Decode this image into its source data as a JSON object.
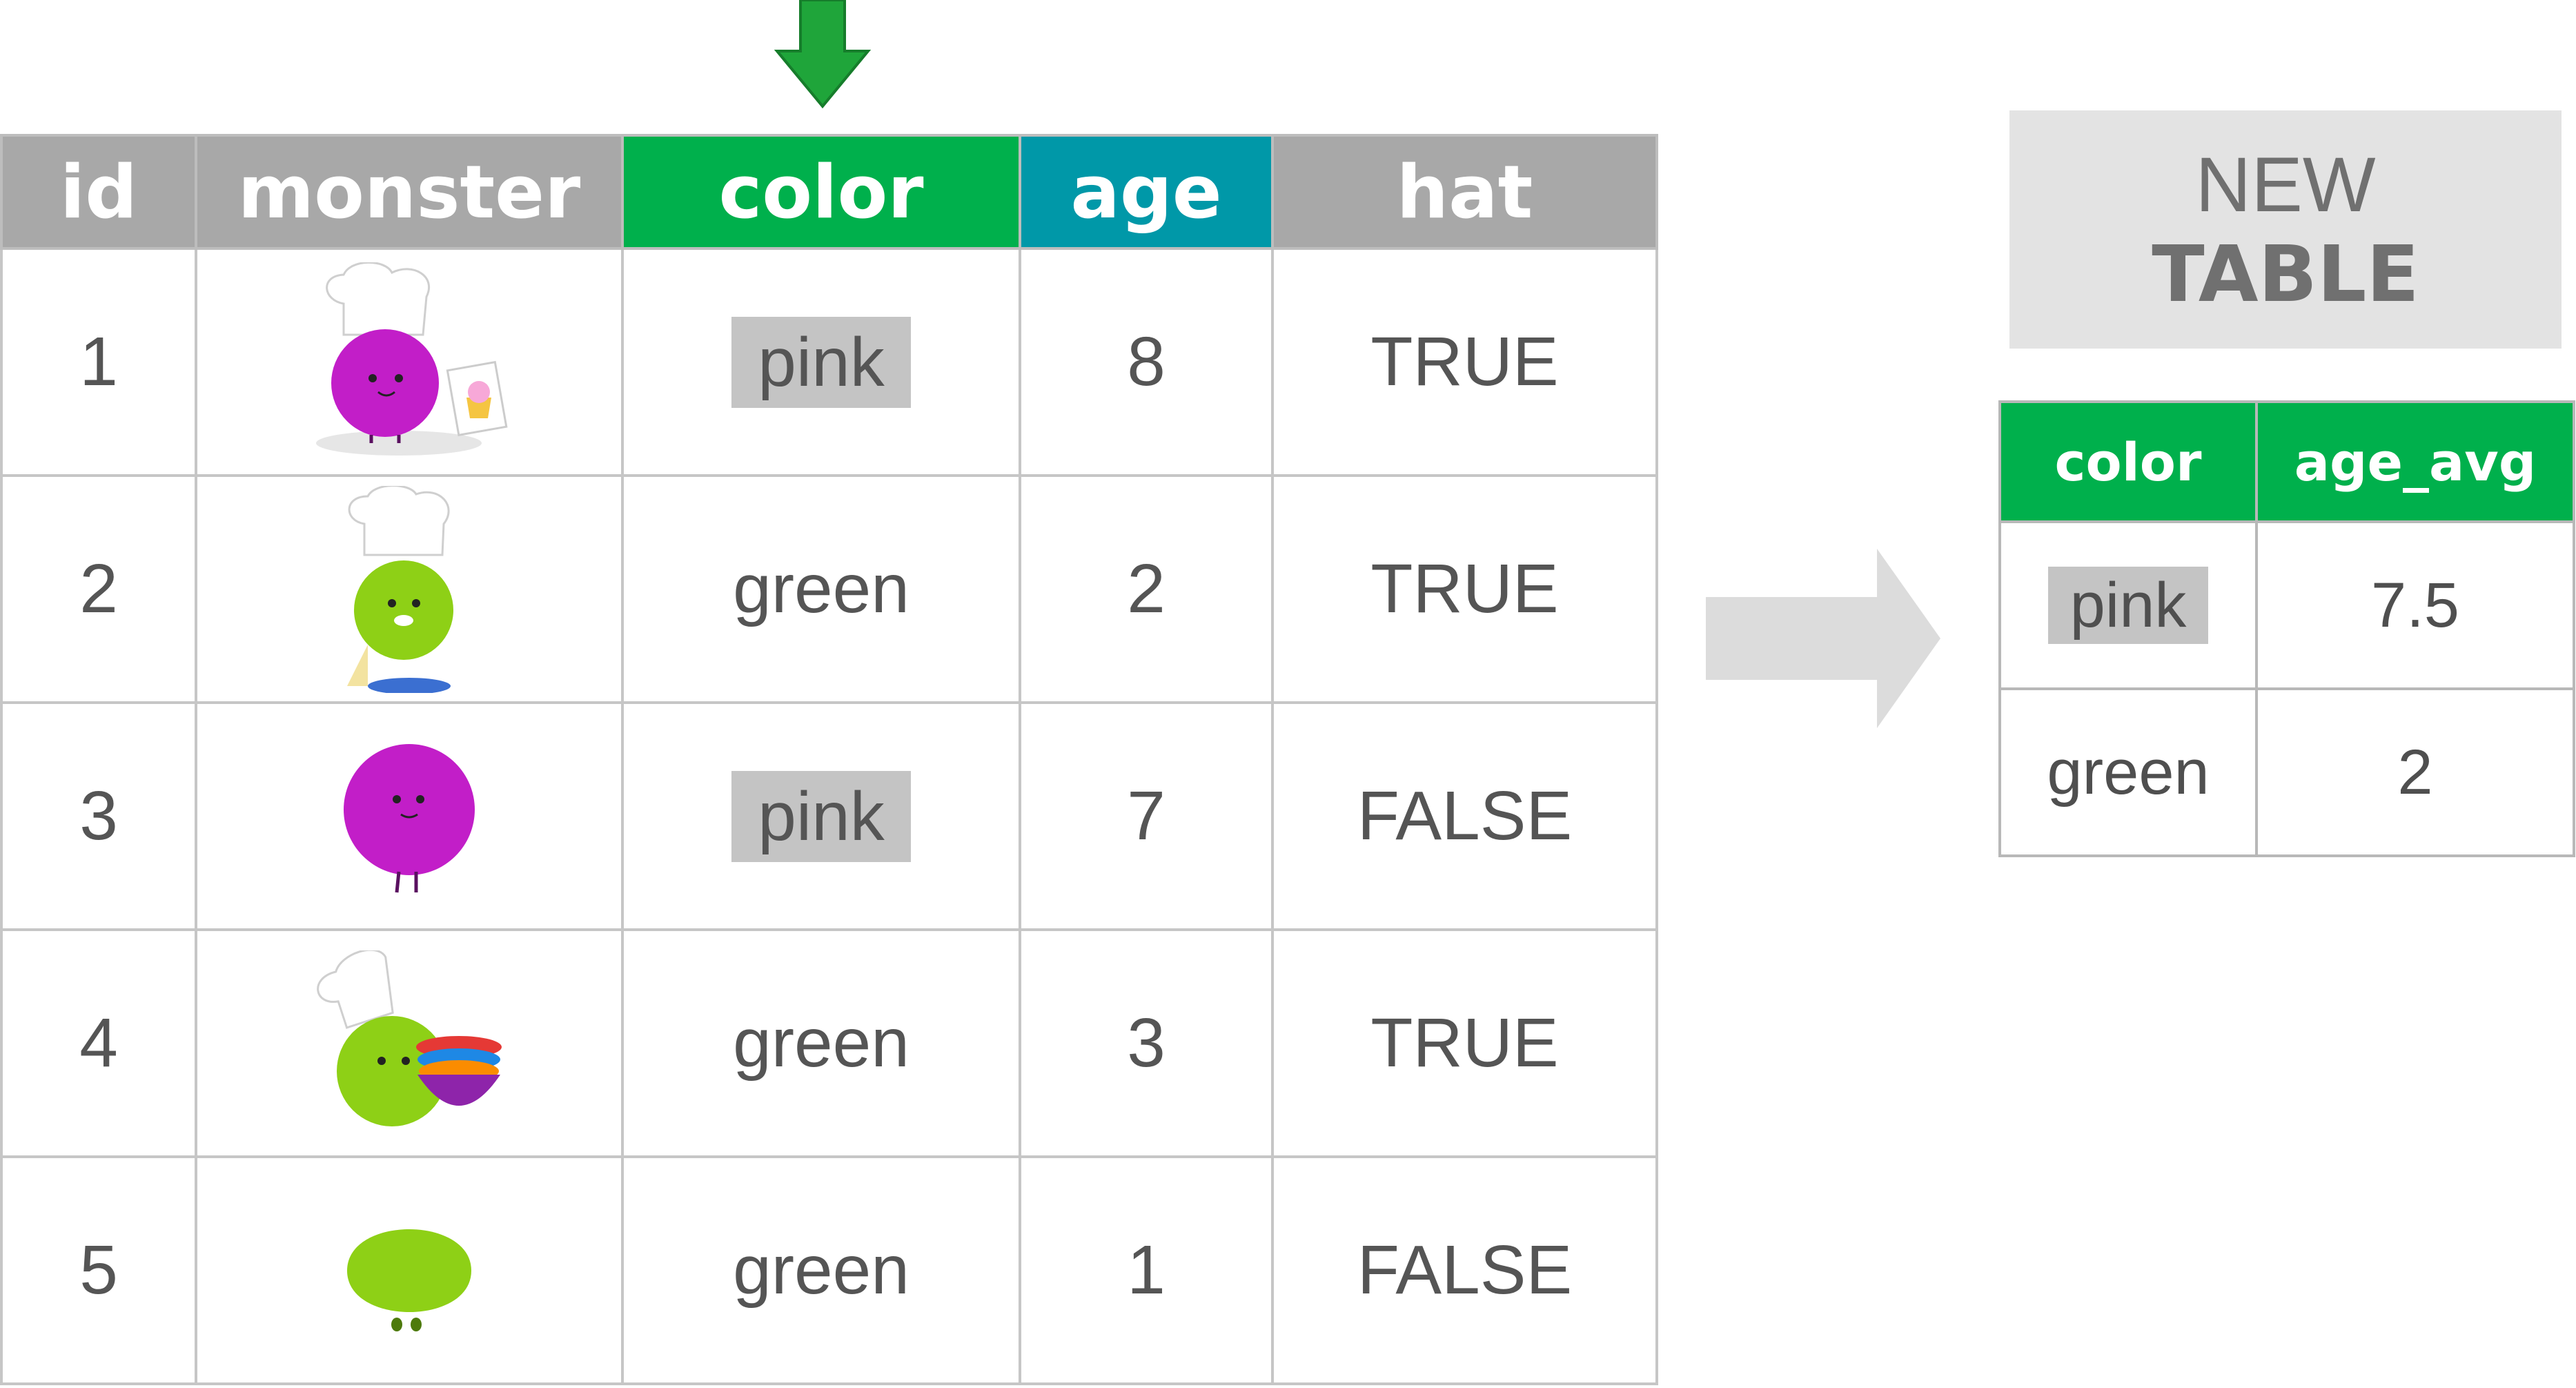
{
  "source_table": {
    "headers": [
      {
        "key": "id",
        "label": "id"
      },
      {
        "key": "monster",
        "label": "monster"
      },
      {
        "key": "color",
        "label": "color"
      },
      {
        "key": "age",
        "label": "age"
      },
      {
        "key": "hat",
        "label": "hat"
      }
    ],
    "rows": [
      {
        "id": "1",
        "monster": "pink chef monster with cupcake",
        "color": "pink",
        "age": "8",
        "hat": "TRUE"
      },
      {
        "id": "2",
        "monster": "green chef monster with piping bag",
        "color": "green",
        "age": "2",
        "hat": "TRUE"
      },
      {
        "id": "3",
        "monster": "pink monster",
        "color": "pink",
        "age": "7",
        "hat": "FALSE"
      },
      {
        "id": "4",
        "monster": "green chef monster with bowls",
        "color": "green",
        "age": "3",
        "hat": "TRUE"
      },
      {
        "id": "5",
        "monster": "green monster",
        "color": "green",
        "age": "1",
        "hat": "FALSE"
      }
    ]
  },
  "new_table": {
    "title_line1": "NEW",
    "title_line2": "TABLE",
    "headers": [
      "color",
      "age_avg"
    ],
    "rows": [
      {
        "color": "pink",
        "age_avg": "7.5"
      },
      {
        "color": "green",
        "age_avg": "2"
      }
    ]
  },
  "colors": {
    "header_grey": "#a8a8a8",
    "group_column_green": "#00b04c",
    "summarized_column_teal": "#0098a8",
    "pink_highlight": "#c4c4c4",
    "arrow_green": "#1fa53a",
    "arrow_grey": "#dcdcdc",
    "monster_pink": "#c21ec8",
    "monster_green": "#8ed016"
  },
  "icons": [
    "down-arrow-icon",
    "right-arrow-icon",
    "chef-hat-icon",
    "cupcake-icon",
    "bowl-icon"
  ]
}
